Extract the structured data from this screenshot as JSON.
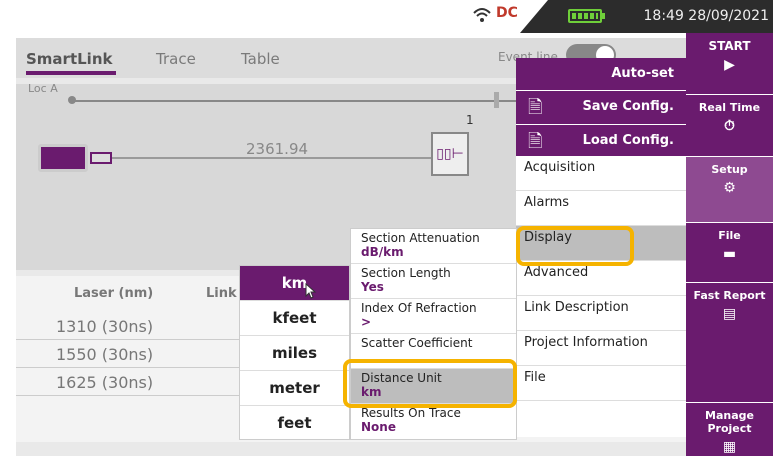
{
  "status": {
    "time": "18:49 28/09/2021",
    "logo": "DC"
  },
  "tabs": [
    {
      "label": "SmartLink"
    },
    {
      "label": "Trace"
    },
    {
      "label": "Table"
    }
  ],
  "event_line": "Event line",
  "loc_label": "Loc A",
  "link": {
    "length": "2361.94",
    "node_number": "1"
  },
  "table": {
    "headers": [
      "Laser (nm)",
      "Link"
    ],
    "rows": [
      "1310 (30ns)",
      "1550 (30ns)",
      "1625 (30ns)"
    ]
  },
  "sidebar": [
    {
      "label": "START",
      "icon": "play-icon"
    },
    {
      "label": "Real Time",
      "icon": "stopwatch-icon"
    },
    {
      "label": "Setup",
      "icon": "gear-icon"
    },
    {
      "label": "File",
      "icon": "folder-icon"
    },
    {
      "label": "Fast Report",
      "icon": "report-icon"
    },
    {
      "label": "Manage Project",
      "icon": "grid-icon"
    }
  ],
  "menu": {
    "top": [
      "Auto-set",
      "Save Config.",
      "Load Config."
    ],
    "items": [
      "Acquisition",
      "Alarms",
      "Display",
      "Advanced",
      "Link Description",
      "Project Information",
      "File"
    ],
    "selected": "Display"
  },
  "submenu": [
    {
      "label": "Section Attenuation",
      "value": "dB/km"
    },
    {
      "label": "Section Length",
      "value": "Yes"
    },
    {
      "label": "Index Of Refraction",
      "value": ">"
    },
    {
      "label": "Scatter Coefficient",
      "value": ""
    },
    {
      "label": "Distance Unit",
      "value": "km"
    },
    {
      "label": "Results On Trace",
      "value": "None"
    }
  ],
  "units": [
    "km",
    "kfeet",
    "miles",
    "meter",
    "feet"
  ],
  "selected_unit": "km",
  "colors": {
    "purple": "#6a1b6e",
    "highlight": "#f5b300"
  }
}
